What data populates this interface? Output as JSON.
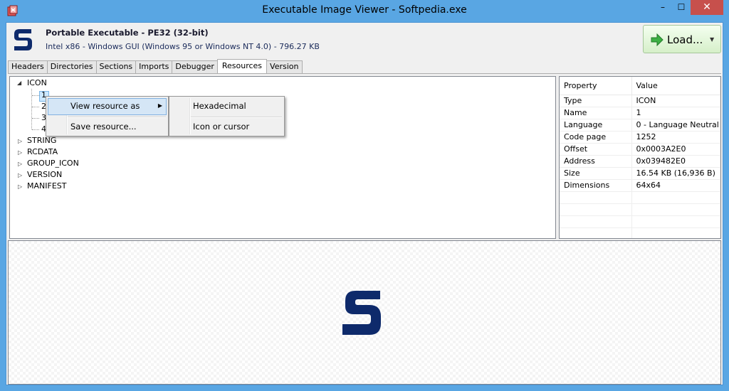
{
  "window": {
    "title": "Executable Image Viewer - Softpedia.exe",
    "minimize": "–",
    "maximize": "☐",
    "close": "✕"
  },
  "header": {
    "title": "Portable Executable - PE32 (32-bit)",
    "subtitle": "Intel x86 - Windows GUI (Windows 95 or Windows NT 4.0) - 796.27 KB",
    "load_label": "Load...",
    "load_dropdown": "▼"
  },
  "tabs": [
    {
      "label": "Headers"
    },
    {
      "label": "Directories"
    },
    {
      "label": "Sections"
    },
    {
      "label": "Imports"
    },
    {
      "label": "Debugger"
    },
    {
      "label": "Resources",
      "active": true
    },
    {
      "label": "Version"
    }
  ],
  "tree": {
    "root": "ICON",
    "children": [
      "1",
      "2",
      "3",
      "4"
    ],
    "others": [
      "STRING",
      "RCDATA",
      "GROUP_ICON",
      "VERSION",
      "MANIFEST"
    ]
  },
  "properties": {
    "headers": [
      "Property",
      "Value"
    ],
    "rows": [
      [
        "Type",
        "ICON"
      ],
      [
        "Name",
        "1"
      ],
      [
        "Language",
        "0 - Language Neutral"
      ],
      [
        "Code page",
        "1252"
      ],
      [
        "Offset",
        "0x0003A2E0"
      ],
      [
        "Address",
        "0x039482E0"
      ],
      [
        "Size",
        "16.54 KB (16,936 B)"
      ],
      [
        "Dimensions",
        "64x64"
      ]
    ]
  },
  "context_menu": {
    "items": [
      "View resource as",
      "Save resource..."
    ],
    "submenu": [
      "Hexadecimal",
      "Icon or cursor"
    ]
  },
  "colors": {
    "titlebar": "#59a6e3",
    "brand": "#0e2a6b",
    "close": "#c7504c"
  }
}
